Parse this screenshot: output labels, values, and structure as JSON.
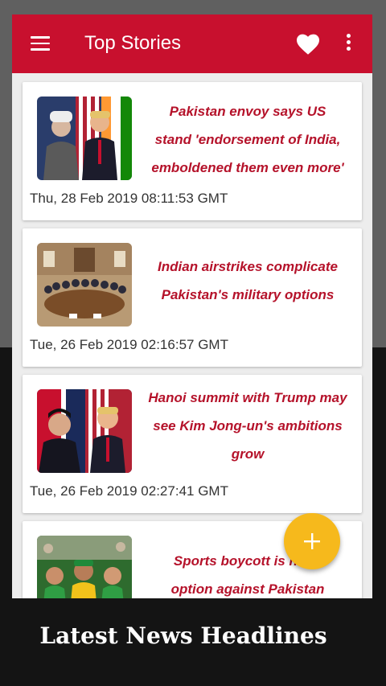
{
  "appbar": {
    "title": "Top Stories",
    "menu_icon": "hamburger-menu-icon",
    "favorite_icon": "heart-icon",
    "overflow_icon": "more-vert-icon",
    "color": "#c8102e"
  },
  "stories": [
    {
      "headline_lines": [
        "Pakistan envoy says US",
        "stand 'endorsement of India,",
        "emboldened them even more'"
      ],
      "date": "Thu, 28 Feb 2019 08:11:53 GMT"
    },
    {
      "headline_lines": [
        "Indian airstrikes complicate",
        "Pakistan's military options"
      ],
      "date": "Tue, 26 Feb 2019 02:16:57 GMT"
    },
    {
      "headline_lines": [
        "Hanoi summit with Trump may",
        "see Kim Jong-un's ambitions",
        "grow"
      ],
      "date": "Tue, 26 Feb 2019 02:27:41 GMT"
    },
    {
      "headline_lines": [
        "Sports boycott is not a",
        "option against Pakistan"
      ],
      "date": ""
    }
  ],
  "fab": {
    "icon": "plus-icon",
    "color": "#f6b91c"
  },
  "caption": "Latest News Headlines"
}
